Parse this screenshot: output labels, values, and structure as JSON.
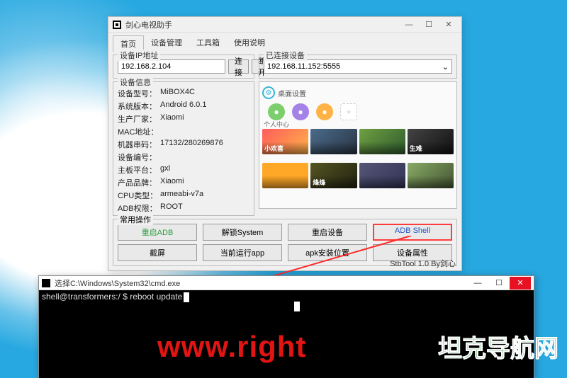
{
  "main_window": {
    "title": "剑心电视助手",
    "tabs": [
      "首页",
      "设备管理",
      "工具箱",
      "使用说明"
    ],
    "active_tab": 0,
    "ip_group": {
      "label": "设备IP地址",
      "value": "192.168.2.104",
      "connect_btn": "连接",
      "disconnect_btn": "断开"
    },
    "connected_group": {
      "label": "已连接设备",
      "value": "192.168.11.152:5555"
    },
    "device_info": {
      "label": "设备信息",
      "rows": [
        {
          "k": "设备型号：",
          "v": "MiBOX4C"
        },
        {
          "k": "系统版本：",
          "v": "Android 6.0.1"
        },
        {
          "k": "生产厂家：",
          "v": "Xiaomi"
        },
        {
          "k": "MAC地址：",
          "v": ""
        },
        {
          "k": "机器串码：",
          "v": "17132/280269876"
        },
        {
          "k": "设备编号：",
          "v": ""
        },
        {
          "k": "主板平台：",
          "v": "gxl"
        },
        {
          "k": "产品品牌：",
          "v": "Xiaomi"
        },
        {
          "k": "CPU类型：",
          "v": "armeabi-v7a"
        },
        {
          "k": "ADB权限：",
          "v": "ROOT"
        }
      ]
    },
    "preview": {
      "badge": "桌面设置",
      "app_icons": [
        {
          "label": "个人中心",
          "color": "#7ccf6c"
        },
        {
          "label": "",
          "color": "#a583e6"
        },
        {
          "label": "",
          "color": "#ffb347"
        },
        {
          "label": "",
          "color": "plus"
        }
      ],
      "thumbs_row1": [
        {
          "label": "小欢喜",
          "bg": "linear-gradient(135deg,#ff5c5c,#ffb347)"
        },
        {
          "label": "",
          "bg": "linear-gradient(135deg,#4a6b8a,#2a3544)"
        },
        {
          "label": "",
          "bg": "linear-gradient(135deg,#6fa040,#2f5c30)"
        },
        {
          "label": "生难",
          "bg": "linear-gradient(135deg,#444,#111)"
        }
      ],
      "thumbs_row2": [
        {
          "label": "",
          "bg": "#ffa726"
        },
        {
          "label": "烽烽",
          "bg": "linear-gradient(135deg,#552,#221)"
        },
        {
          "label": "",
          "bg": "linear-gradient(135deg,#557,#335)"
        },
        {
          "label": "",
          "bg": "linear-gradient(135deg,#8a6,#453)"
        }
      ]
    },
    "ops": {
      "label": "常用操作",
      "buttons": [
        "重启ADB",
        "解锁System",
        "重启设备",
        "ADB Shell",
        "截屏",
        "当前运行app",
        "apk安装位置",
        "设备属性"
      ]
    },
    "statusbar": "StbTool 1.0 By剑心"
  },
  "cmd_window": {
    "title": "选择C:\\Windows\\System32\\cmd.exe",
    "line": "shell@transformers:/ $ reboot update"
  },
  "watermarks": {
    "wm1": "www.right",
    "wm2": "坦克导航网"
  }
}
